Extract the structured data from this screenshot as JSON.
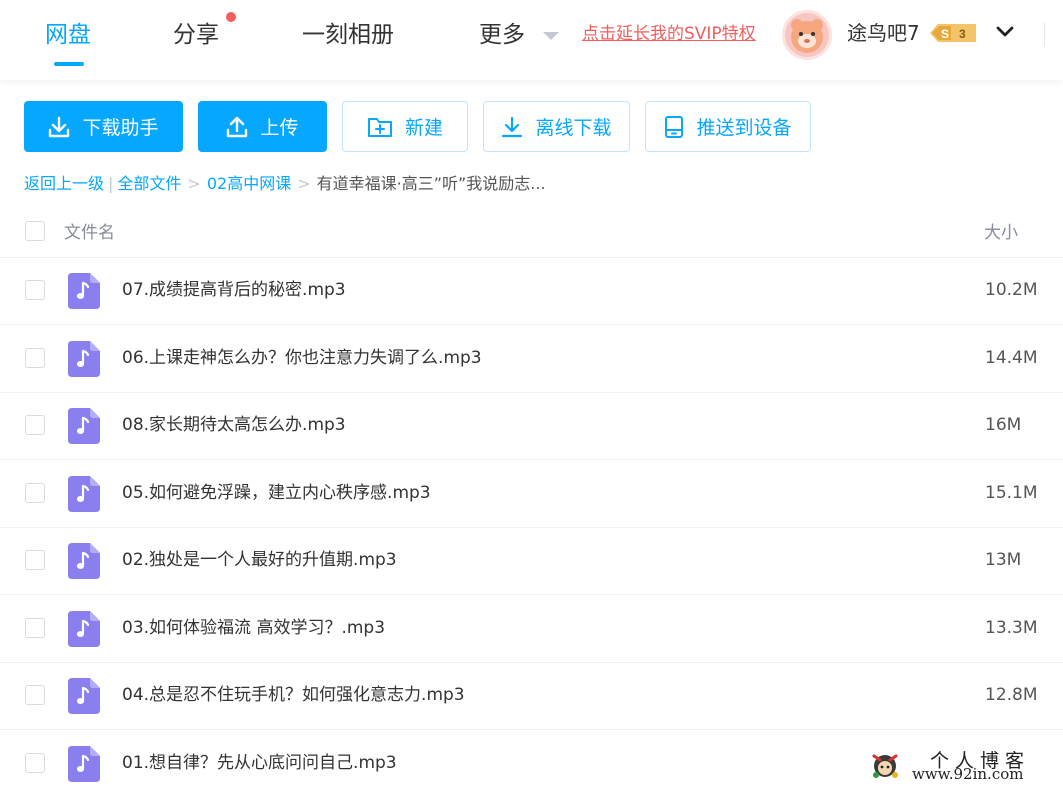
{
  "header": {
    "tabs": [
      {
        "label": "网盘",
        "active": true
      },
      {
        "label": "分享",
        "has_dot": true
      },
      {
        "label": "一刻相册"
      },
      {
        "label": "更多"
      }
    ],
    "svip_link": "点击延长我的SVIP特权",
    "username": "途鸟吧7",
    "vip_badge_letter": "S",
    "vip_badge_level": "3",
    "accent_color": "#06a7ff",
    "alert_color": "#f25d5d"
  },
  "toolbar": {
    "download_helper": "下载助手",
    "upload": "上传",
    "new": "新建",
    "offline_download": "离线下载",
    "push_to_device": "推送到设备"
  },
  "breadcrumb": {
    "back": "返回上一级",
    "all_files": "全部文件",
    "folder": "02高中网课",
    "current": "有道幸福课·高三”听”我说励志..."
  },
  "table": {
    "col_name": "文件名",
    "col_size": "大小",
    "rows": [
      {
        "name": "07.成绩提高背后的秘密.mp3",
        "size": "10.2M"
      },
      {
        "name": "06.上课走神怎么办？你也注意力失调了么.mp3",
        "size": "14.4M"
      },
      {
        "name": "08.家长期待太高怎么办.mp3",
        "size": "16M"
      },
      {
        "name": "05.如何避免浮躁，建立内心秩序感.mp3",
        "size": "15.1M"
      },
      {
        "name": "02.独处是一个人最好的升值期.mp3",
        "size": "13M"
      },
      {
        "name": "03.如何体验福流 高效学习？.mp3",
        "size": "13.3M"
      },
      {
        "name": "04.总是忍不住玩手机？如何强化意志力.mp3",
        "size": "12.8M"
      },
      {
        "name": "01.想自律？先从心底问问自己.mp3",
        "size": ""
      }
    ]
  },
  "watermark": {
    "title": "个人博客",
    "url": "www.92in.com"
  }
}
